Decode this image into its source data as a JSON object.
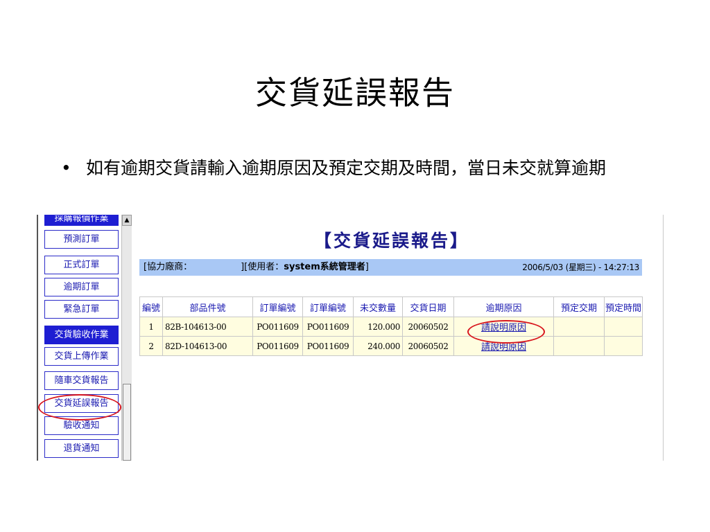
{
  "slide": {
    "title": "交貨延誤報告",
    "bullet_mark": "•",
    "bullet_text": "如有逾期交貨請輸入逾期原因及預定交期及時間，當日未交就算逾期"
  },
  "nav": {
    "items": [
      {
        "label": "採購報價作業",
        "type": "section"
      },
      {
        "label": "預測訂單",
        "type": "item"
      },
      {
        "label": "正式訂單",
        "type": "item"
      },
      {
        "label": "逾期訂單",
        "type": "item"
      },
      {
        "label": "緊急訂單",
        "type": "item"
      },
      {
        "label": "交貨驗收作業",
        "type": "section"
      },
      {
        "label": "交貨上傳作業",
        "type": "item"
      },
      {
        "label": "隨車交貨報告",
        "type": "item"
      },
      {
        "label": "交貨延誤報告",
        "type": "item"
      },
      {
        "label": "驗收通知",
        "type": "item"
      },
      {
        "label": "退貨通知",
        "type": "item"
      }
    ],
    "scroll_up_glyph": "▲"
  },
  "report": {
    "title": "【交貨延誤報告】",
    "vendor_label": "[協力廠商：",
    "vendor_close": "]",
    "user_label": "[使用者：",
    "user_value": "system系統管理者",
    "user_close": "]",
    "datetime": "2006/5/03 (星期三) - 14:27:13"
  },
  "table": {
    "headers": [
      "編號",
      "部品件號",
      "訂單編號",
      "訂單編號",
      "未交數量",
      "交貨日期",
      "逾期原因",
      "預定交期",
      "預定時間"
    ],
    "rows": [
      {
        "no": "1",
        "part": "82B-104613-00",
        "order1": "PO011609",
        "order2": "PO011609",
        "qty": "120.000",
        "date": "20060502",
        "reason": "請說明原因",
        "plan_date": "",
        "plan_time": ""
      },
      {
        "no": "2",
        "part": "82D-104613-00",
        "order1": "PO011609",
        "order2": "PO011609",
        "qty": "240.000",
        "date": "20060502",
        "reason": "請說明原因",
        "plan_date": "",
        "plan_time": ""
      }
    ]
  },
  "colors": {
    "highlight": "#d8161e",
    "nav_section": "#1e1ed2",
    "info_bar": "#a9c8f5",
    "row_bg": "#fffde0"
  }
}
